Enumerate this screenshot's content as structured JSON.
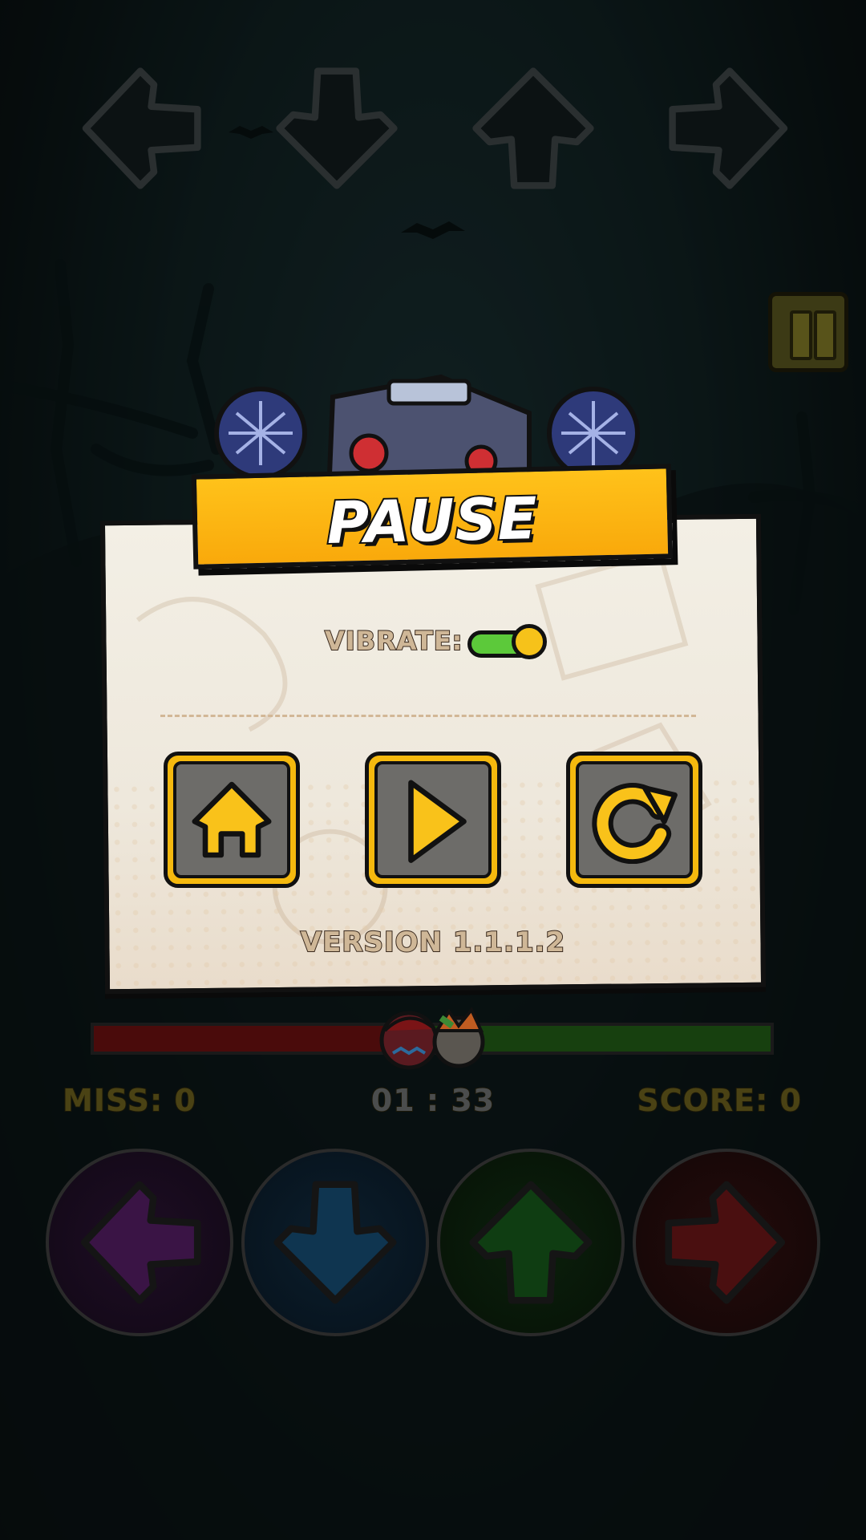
{
  "dialog": {
    "title": "PAUSE",
    "vibrate_label": "VIBRATE:",
    "vibrate_on": true,
    "buttons": [
      {
        "name": "home",
        "icon": "home-icon"
      },
      {
        "name": "resume",
        "icon": "play-icon"
      },
      {
        "name": "restart",
        "icon": "restart-icon"
      }
    ],
    "version": "VERSION 1.1.1.2"
  },
  "hud": {
    "miss_label": "MISS:",
    "miss_value": "0",
    "time": "01 : 33",
    "score_label": "SCORE:",
    "score_value": "0",
    "health_fraction": 0.5
  },
  "colors": {
    "accent_yellow": "#f9b10f",
    "toggle_green": "#5cc93a",
    "pad_left": "#3a1445",
    "pad_down": "#0f3550",
    "pad_up": "#0f3d12",
    "pad_right": "#4a0f10"
  }
}
